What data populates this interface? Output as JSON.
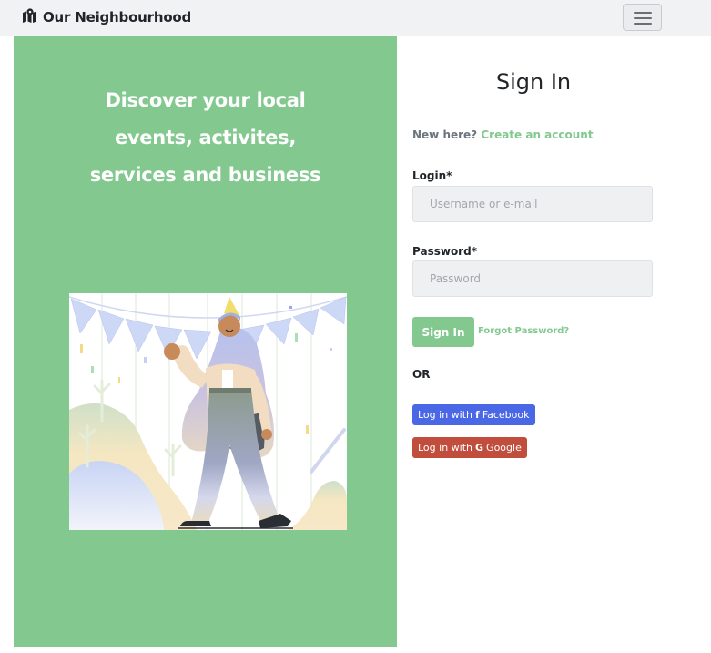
{
  "nav": {
    "brand": "Our Neighbourhood",
    "brand_icon": "map-icon",
    "menu_icon": "hamburger-icon"
  },
  "hero": {
    "tagline_lines": [
      "Discover your local",
      "events, activites,",
      "services and business"
    ],
    "colors": {
      "background": "#83c98f"
    }
  },
  "signin": {
    "title": "Sign In",
    "new_here": "New here?",
    "create_account": "Create an account",
    "login_label": "Login*",
    "login_placeholder": "Username or e-mail",
    "password_label": "Password*",
    "password_placeholder": "Password",
    "submit_label": "Sign In",
    "forgot_label": "Forgot Password?",
    "or_label": "OR",
    "facebook": {
      "prefix": "Log in with",
      "icon": "f",
      "name": "Facebook",
      "color": "#4a67e6"
    },
    "google": {
      "prefix": "Log in with",
      "icon": "G",
      "name": "Google",
      "color": "#c14d3d"
    }
  },
  "colors": {
    "accent": "#83c98f"
  }
}
